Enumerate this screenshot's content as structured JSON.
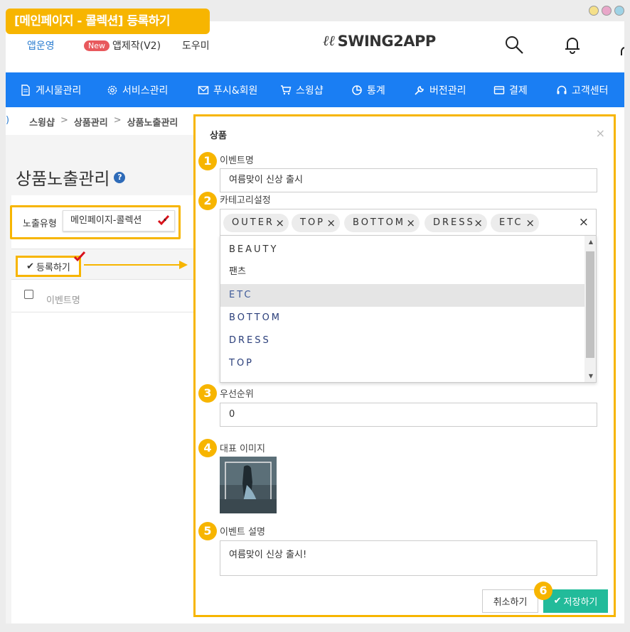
{
  "badge": {
    "title": "[메인페이지 - 콜렉션] 등록하기"
  },
  "top": {
    "nav_operate": "앱운영",
    "new_badge": "New",
    "nav_make": "앱제작(V2)",
    "nav_help": "도우미",
    "logo": "SWING2APP",
    "logo_mark": "ℓℓ"
  },
  "menu": [
    {
      "label": "게시물관리",
      "icon": "document-icon"
    },
    {
      "label": "서비스관리",
      "icon": "gear-icon"
    },
    {
      "label": "푸시&회원",
      "icon": "mail-icon"
    },
    {
      "label": "스윙샵",
      "icon": "cart-icon"
    },
    {
      "label": "통계",
      "icon": "pie-chart-icon"
    },
    {
      "label": "버전관리",
      "icon": "wrench-icon"
    },
    {
      "label": "결제",
      "icon": "card-icon"
    },
    {
      "label": "고객센터",
      "icon": "headset-icon"
    }
  ],
  "breadcrumb": {
    "shop": "스윙샵",
    "sep": ">",
    "manage": "상품관리",
    "current": "상품노출관리"
  },
  "page": {
    "title": "상품노출관리",
    "help": "?",
    "expo_label": "노출유형",
    "expo_value": "메인페이지-콜렉션",
    "register": "등록하기",
    "col_event": "이벤트명"
  },
  "modal": {
    "title": "상품",
    "close": "×",
    "nums": [
      "1",
      "2",
      "3",
      "4",
      "5",
      "6"
    ],
    "event_name_label": "이벤트명",
    "event_name_value": "여름맞이 신상 출시",
    "category_label": "카테고리설정",
    "tags": [
      "OUTER",
      "TOP",
      "BOTTOM",
      "DRESS",
      "ETC"
    ],
    "tag_remove": "×",
    "tags_clear": "×",
    "dropdown": [
      "BEAUTY",
      "팬츠",
      "ETC",
      "BOTTOM",
      "DRESS",
      "TOP"
    ],
    "dropdown_selected": "ETC",
    "priority_label": "우선순위",
    "priority_value": "0",
    "image_label": "대표 이미지",
    "desc_label": "이벤트 설명",
    "desc_value": "여름맞이 신상 출시!",
    "cancel": "취소하기",
    "save": "저장하기"
  },
  "colors": {
    "accent": "#f7b500",
    "menu": "#1a7ef3",
    "save": "#22bb9a",
    "badge_new": "#e8595d"
  }
}
